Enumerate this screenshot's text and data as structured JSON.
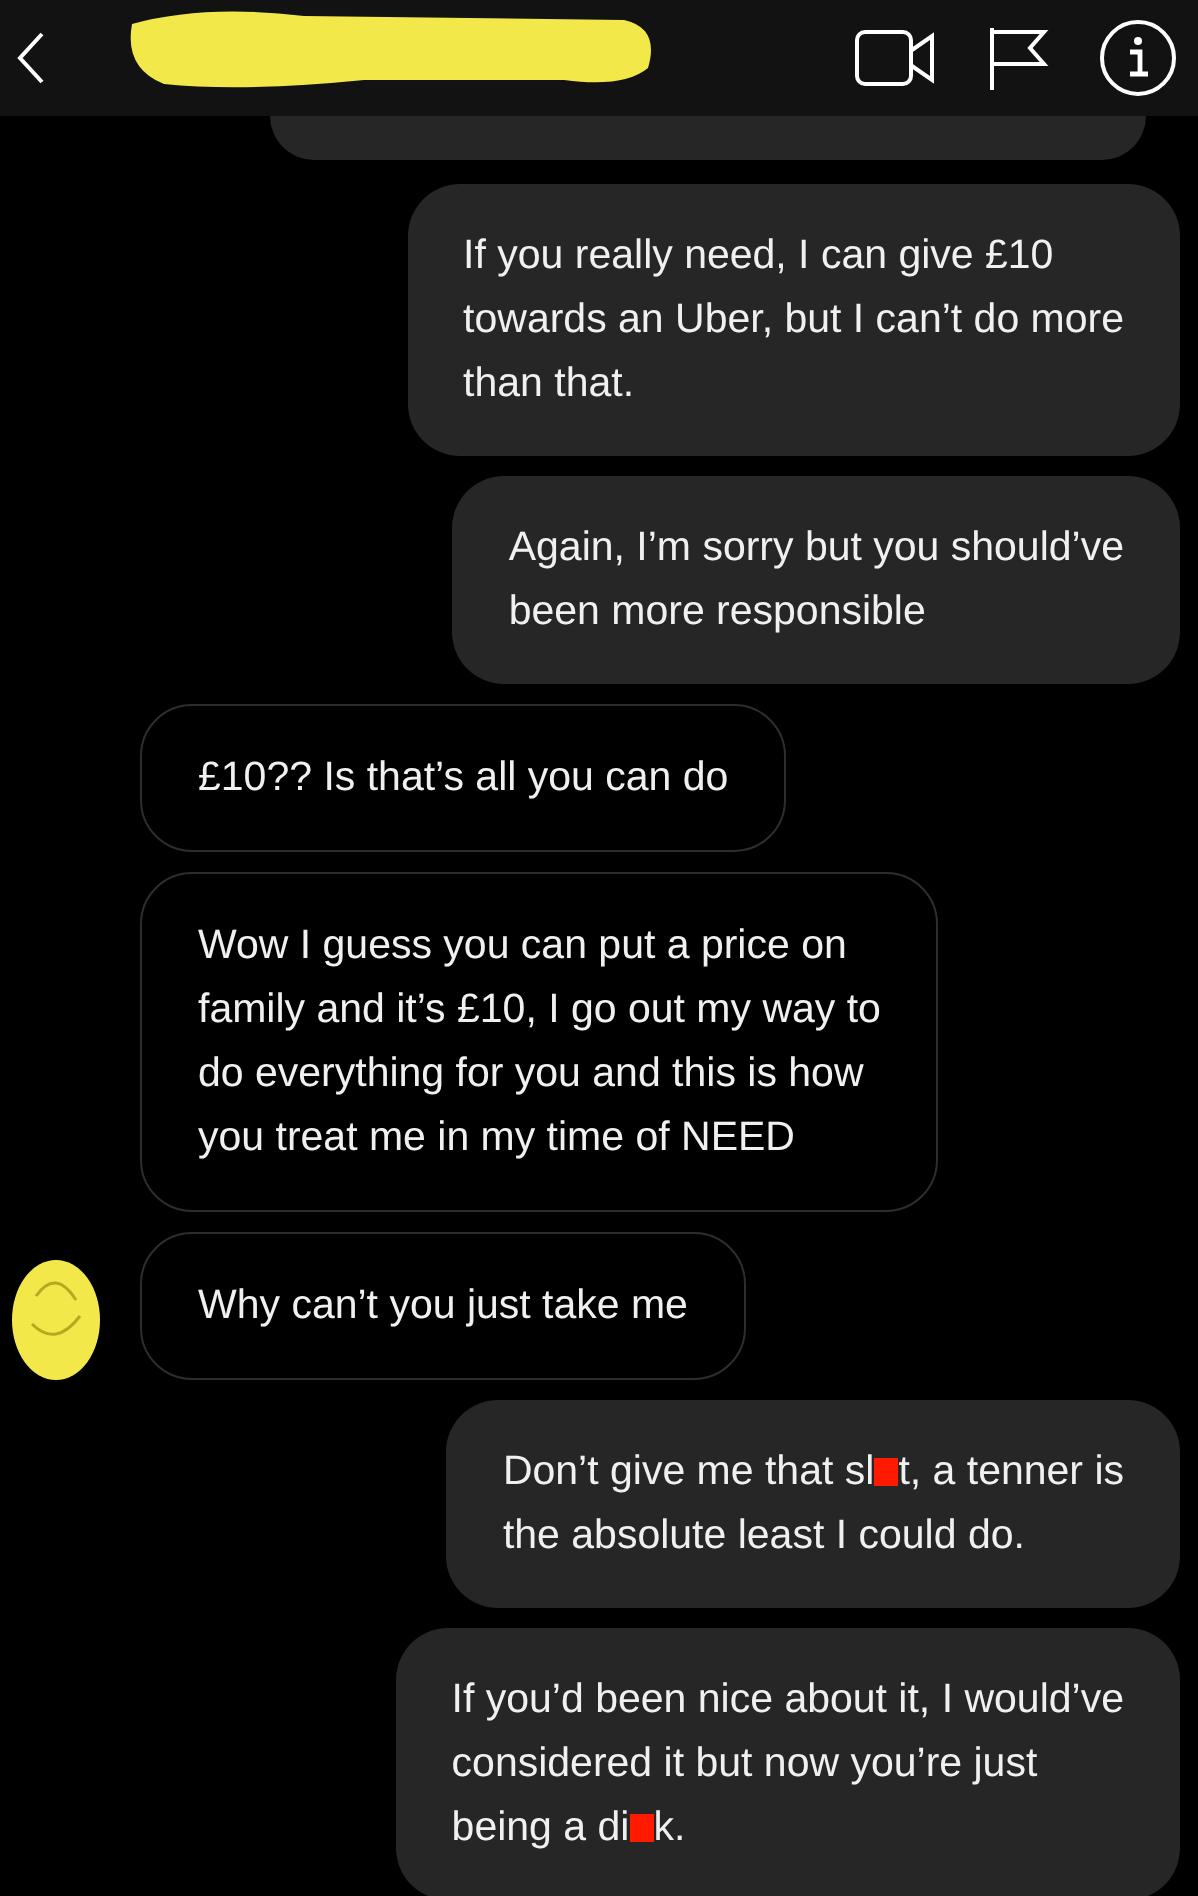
{
  "header": {
    "name_redacted": true
  },
  "messages": [
    {
      "kind": "clipped",
      "sent": true
    },
    {
      "kind": "text",
      "sent": true,
      "lines": [
        "If you really need, I can give £10",
        "towards an Uber, but I can’t do more",
        "than that."
      ]
    },
    {
      "kind": "text",
      "sent": true,
      "lines": [
        "Again, I’m sorry but you should’ve",
        "been more responsible"
      ]
    },
    {
      "kind": "text",
      "sent": false,
      "lines": [
        "£10?? Is that’s all you can do"
      ]
    },
    {
      "kind": "text",
      "sent": false,
      "lines": [
        "Wow I guess you can put a price on",
        "family and it’s £10, I go out my way to",
        "do everything for you and this is how",
        "you treat me in my time of NEED"
      ]
    },
    {
      "kind": "text",
      "sent": false,
      "avatar_redacted": true,
      "lines": [
        "Why can’t you just take me"
      ]
    },
    {
      "kind": "text",
      "sent": true,
      "lines": [
        [
          {
            "text": "Don’t give me that sl"
          },
          {
            "censor": true
          },
          {
            "text": "t, a tenner is"
          }
        ],
        "the absolute least I could do."
      ]
    },
    {
      "kind": "text",
      "sent": true,
      "lines": [
        "If you’d been nice about it, I would’ve",
        "considered it but now you’re just",
        [
          {
            "text": "being a di"
          },
          {
            "censor": true
          },
          {
            "text": "k."
          }
        ]
      ]
    }
  ]
}
